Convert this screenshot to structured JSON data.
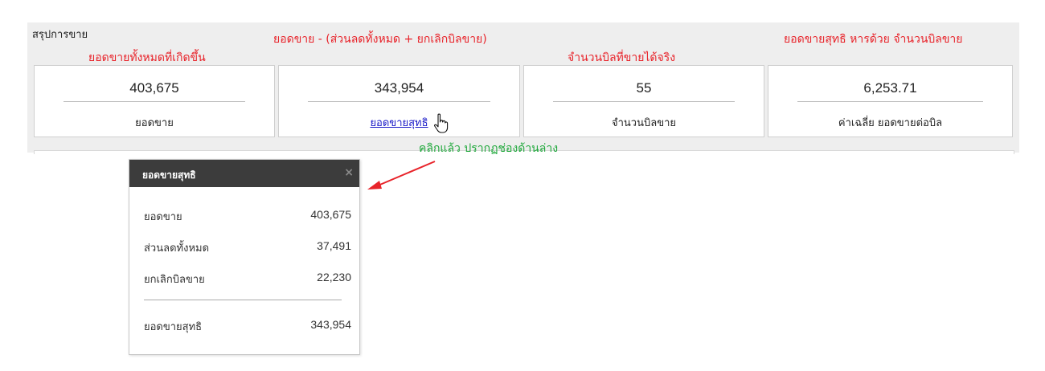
{
  "panel": {
    "title": "สรุปการขาย"
  },
  "annotations": {
    "formula": "ยอดขาย - (ส่วนลดทั้งหมด + ยกเลิกบิลขาย)",
    "average": "ยอดขายสุทธิ หารด้วย จำนวนบิลขาย",
    "total_sales": "ยอดขายทั้งหมดที่เกิดขึ้น",
    "real_bills": "จำนวนบิลที่ขายได้จริง",
    "click_hint": "คลิกแล้ว ปรากฏช่องด้านล่าง",
    "arrow_color": "#e8232a"
  },
  "cards": [
    {
      "value": "403,675",
      "label": "ยอดขาย"
    },
    {
      "value": "343,954",
      "label": "ยอดขายสุทธิ"
    },
    {
      "value": "55",
      "label": "จำนวนบิลขาย"
    },
    {
      "value": "6,253.71",
      "label": "ค่าเฉลี่ย ยอดขายต่อบิล"
    }
  ],
  "popup": {
    "title": "ยอดขายสุทธิ",
    "close_icon": "×",
    "rows": [
      {
        "label": "ยอดขาย",
        "value": "403,675"
      },
      {
        "label": "ส่วนลดทั้งหมด",
        "value": "37,491"
      },
      {
        "label": "ยกเลิกบิลขาย",
        "value": "22,230"
      }
    ],
    "total": {
      "label": "ยอดขายสุทธิ",
      "value": "343,954"
    }
  }
}
